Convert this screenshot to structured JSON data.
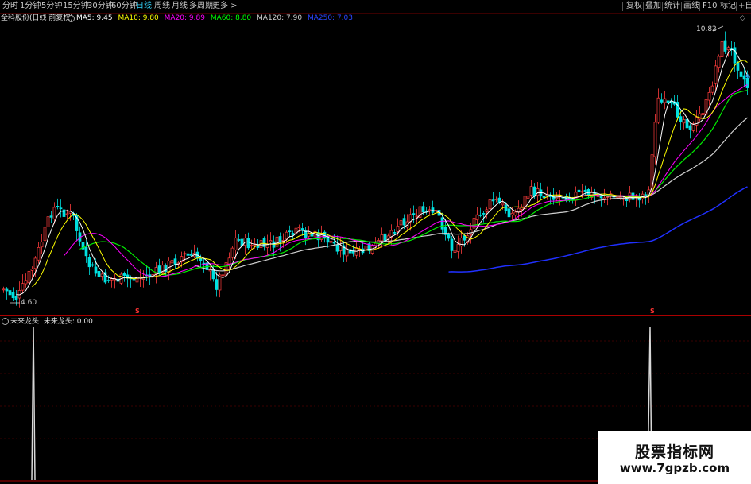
{
  "toolbar": {
    "periods": [
      "分时",
      "1分钟",
      "5分钟",
      "15分钟",
      "30分钟",
      "60分钟",
      "日线",
      "周线",
      "月线",
      "多周期",
      "更多 >"
    ],
    "active_period": "日线",
    "right_buttons": [
      "复权",
      "叠加",
      "统计",
      "画线",
      "F10",
      "标记",
      "+自"
    ]
  },
  "main_chart": {
    "stock_name": "全科股份(日线 前复权)",
    "ma_legend": [
      {
        "label": "MA5: 9.45",
        "color": "#ffffff"
      },
      {
        "label": "MA10: 9.80",
        "color": "#ffff00"
      },
      {
        "label": "MA20: 9.89",
        "color": "#ff00ff"
      },
      {
        "label": "MA60: 8.80",
        "color": "#00ff00"
      },
      {
        "label": "MA120: 7.90",
        "color": "#cfcfcf"
      },
      {
        "label": "MA250: 7.03",
        "color": "#2b46ff"
      }
    ],
    "high_label": "10.82",
    "low_label": "4.60",
    "right_edge_label": "9",
    "event_markers": [
      "S",
      "S"
    ]
  },
  "sub_chart": {
    "indicator_name": "未来龙头",
    "indicator_value": "未来龙头: 0.00"
  },
  "watermark": {
    "line1": "股票指标网",
    "line2": "www.7gpzb.com"
  },
  "colors": {
    "background": "#000000",
    "candle_up": "#ff3c3c",
    "candle_down": "#00e0e0",
    "divider": "#aa0000",
    "active_tab": "#33d7ff",
    "signal": "#d8d8d8"
  }
}
